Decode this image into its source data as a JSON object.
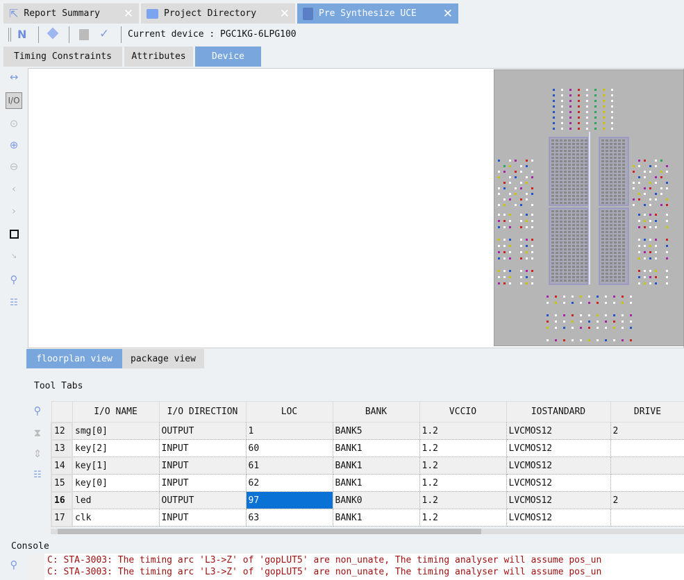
{
  "tabs": [
    {
      "label": "Report Summary",
      "icon": "report-icon"
    },
    {
      "label": "Project Directory",
      "icon": "folder-icon"
    },
    {
      "label": "Pre Synthesize UCE",
      "icon": "clipboard-edit-icon",
      "active": true
    }
  ],
  "toolbar": {
    "current_device_label": "Current device : PGC1KG-6LPG100"
  },
  "subtabs": [
    {
      "label": "Timing Constraints"
    },
    {
      "label": "Attributes"
    },
    {
      "label": "Device",
      "active": true
    }
  ],
  "left_tools": [
    "fit-icon",
    "io-icon",
    "zoom-select-icon",
    "zoom-in-icon",
    "zoom-out-icon",
    "back-icon",
    "forward-icon",
    "rectangle-icon",
    "route-icon",
    "search-icon",
    "hierarchy-icon"
  ],
  "view_tabs": [
    {
      "label": "floorplan view",
      "active": true
    },
    {
      "label": "package view"
    }
  ],
  "tool_tabs_label": "Tool Tabs",
  "table": {
    "columns": [
      "I/O NAME",
      "I/O DIRECTION",
      "LOC",
      "BANK",
      "VCCIO",
      "IOSTANDARD",
      "DRIVE"
    ],
    "rows": [
      {
        "n": "12",
        "cells": [
          "smg[0]",
          "OUTPUT",
          "1",
          "BANK5",
          "1.2",
          "LVCMOS12",
          "2"
        ]
      },
      {
        "n": "13",
        "cells": [
          "key[2]",
          "INPUT",
          "60",
          "BANK1",
          "1.2",
          "LVCMOS12",
          ""
        ]
      },
      {
        "n": "14",
        "cells": [
          "key[1]",
          "INPUT",
          "61",
          "BANK1",
          "1.2",
          "LVCMOS12",
          ""
        ]
      },
      {
        "n": "15",
        "cells": [
          "key[0]",
          "INPUT",
          "62",
          "BANK1",
          "1.2",
          "LVCMOS12",
          ""
        ]
      },
      {
        "n": "16",
        "cells": [
          "led",
          "OUTPUT",
          "97",
          "BANK0",
          "1.2",
          "LVCMOS12",
          "2"
        ],
        "selected_col": 2
      },
      {
        "n": "17",
        "cells": [
          "clk",
          "INPUT",
          "63",
          "BANK1",
          "1.2",
          "LVCMOS12",
          ""
        ]
      }
    ]
  },
  "console": {
    "label": "Console",
    "lines": [
      "C: STA-3003: The timing arc 'L3->Z' of 'gopLUT5' are non_unate, The timing analyser will assume pos_un",
      "C: STA-3003: The timing arc 'L3->Z' of 'gopLUT5' are non_unate, The timing analyser will assume pos_un"
    ]
  },
  "colors": {
    "accent": "#79a6dc",
    "selection": "#0a72d4",
    "console_text": "#a01010"
  }
}
